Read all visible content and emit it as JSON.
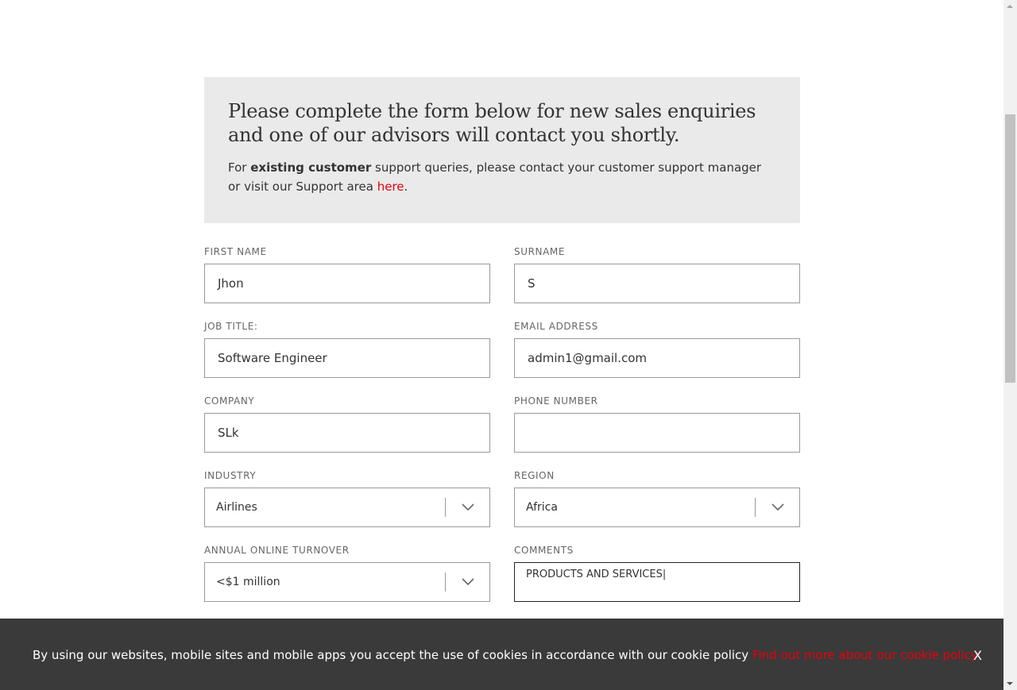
{
  "intro": {
    "heading": "Please complete the form below for new sales enquiries and one of our advisors will contact you shortly.",
    "text_before": "For ",
    "text_bold": "existing customer",
    "text_after": " support queries, please contact your customer support manager or visit our Support area ",
    "link": "here",
    "text_end": "."
  },
  "form": {
    "first_name": {
      "label": "FIRST NAME",
      "value": "Jhon"
    },
    "surname": {
      "label": "SURNAME",
      "value": "S"
    },
    "job_title": {
      "label": "JOB TITLE:",
      "value": "Software Engineer"
    },
    "email": {
      "label": "EMAIL ADDRESS",
      "value": "admin1@gmail.com"
    },
    "company": {
      "label": "COMPANY",
      "value": "SLk"
    },
    "phone": {
      "label": "PHONE NUMBER",
      "value": ""
    },
    "industry": {
      "label": "INDUSTRY",
      "value": "Airlines"
    },
    "region": {
      "label": "REGION",
      "value": "Africa"
    },
    "turnover": {
      "label": "ANNUAL ONLINE TURNOVER",
      "value": "<$1 million"
    },
    "comments": {
      "label": "COMMENTS",
      "value": "PRODUCTS AND SERVICES|"
    }
  },
  "cookie": {
    "message": "By using our websites, mobile sites and mobile apps you accept the use of cookies in accordance with our cookie policy ",
    "link": "Find out more about our cookie policy",
    "close": "X"
  },
  "colors": {
    "accent": "#e8000d",
    "banner": "#3a3a3a",
    "intro_bg": "#eaeaea"
  },
  "icons": {
    "select": "chevron-down-icon"
  }
}
